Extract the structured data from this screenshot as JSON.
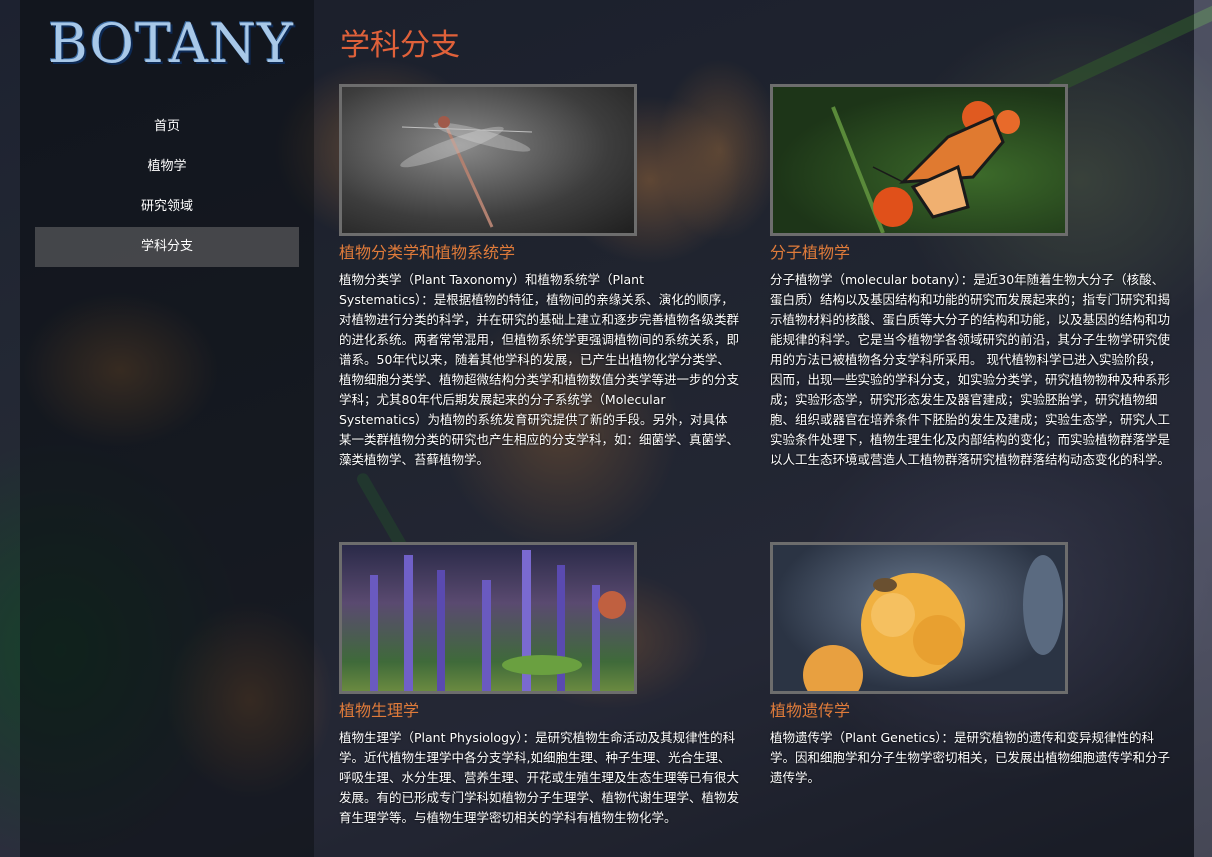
{
  "logo": "BOTANY",
  "nav": {
    "items": [
      "首页",
      "植物学",
      "研究领域",
      "学科分支"
    ],
    "active_index": 3
  },
  "page_title": "学科分支",
  "cards": [
    {
      "title": "植物分类学和植物系统学",
      "image": "dragonfly-photo",
      "text": "植物分类学（Plant Taxonomy）和植物系统学（Plant Systematics）：是根据植物的特征，植物间的亲缘关系、演化的顺序，对植物进行分类的科学，并在研究的基础上建立和逐步完善植物各级类群的进化系统。两者常常混用，但植物系统学更强调植物间的系统关系，即谱系。50年代以来，随着其他学科的发展，已产生出植物化学分类学、植物细胞分类学、植物超微结构分类学和植物数值分类学等进一步的分支学科；尤其80年代后期发展起来的分子系统学（Molecular Systematics）为植物的系统发育研究提供了新的手段。另外，对具体某一类群植物分类的研究也产生相应的分支学科，如：细菌学、真菌学、藻类植物学、苔藓植物学。"
    },
    {
      "title": "分子植物学",
      "image": "butterfly-photo",
      "text": "分子植物学（molecular botany）：是近30年随着生物大分子（核酸、蛋白质）结构以及基因结构和功能的研究而发展起来的；指专门研究和揭示植物材料的核酸、蛋白质等大分子的结构和功能，以及基因的结构和功能规律的科学。它是当今植物学各领域研究的前沿，其分子生物学研究使用的方法已被植物各分支学科所采用。 现代植物科学已进入实验阶段，因而，出现一些实验的学科分支，如实验分类学，研究植物物种及种系形成；实验形态学，研究形态发生及器官建成；实验胚胎学，研究植物细胞、组织或器官在培养条件下胚胎的发生及建成；实验生态学，研究人工实验条件处理下，植物生理生化及内部结构的变化；而实验植物群落学是以人工生态环境或营造人工植物群落研究植物群落结构动态变化的科学。"
    },
    {
      "title": "植物生理学",
      "image": "lavender-photo",
      "text": "植物生理学（Plant Physiology）：是研究植物生命活动及其规律性的科学。近代植物生理学中各分支学科,如细胞生理、种子生理、光合生理、呼吸生理、水分生理、营养生理、开花或生殖生理及生态生理等已有很大发展。有的已形成专门学科如植物分子生理学、植物代谢生理学、植物发育生理学等。与植物生理学密切相关的学科有植物生物化学。"
    },
    {
      "title": "植物遗传学",
      "image": "marigold-photo",
      "text": "植物遗传学（Plant Genetics）：是研究植物的遗传和变异规律性的科学。因和细胞学和分子生物学密切相关，已发展出植物细胞遗传学和分子遗传学。"
    }
  ]
}
